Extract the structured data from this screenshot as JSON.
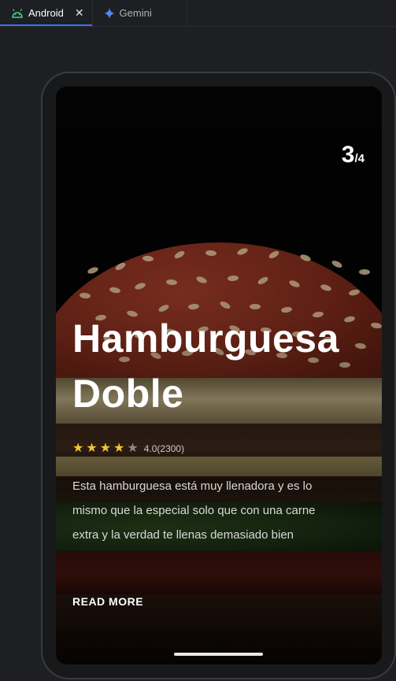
{
  "tabs": [
    {
      "label": "Android",
      "icon": "android-icon",
      "active": true
    },
    {
      "label": "Gemini",
      "icon": "gemini-icon",
      "active": false
    }
  ],
  "card": {
    "page_current": "3",
    "page_total": "/4",
    "title": "Hamburguesa Doble",
    "rating": {
      "value": 4,
      "max": 5,
      "text": "4.0(2300)"
    },
    "description": "Esta hamburguesa está muy llenadora y es lo mismo que la especial solo que con una carne extra y la verdad te llenas demasiado bien",
    "read_more": "READ MORE"
  },
  "colors": {
    "star_on": "#f2c62e",
    "star_off": "#8a8a8a",
    "accent": "#3574f0"
  }
}
